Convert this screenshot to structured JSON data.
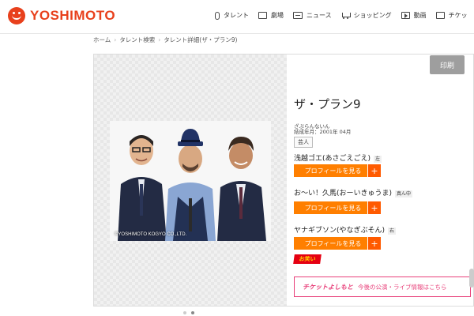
{
  "brand": {
    "name": "YOSHIMOTO",
    "color": "#e8401c"
  },
  "nav": [
    {
      "label": "タレント",
      "icon": "mic-icon"
    },
    {
      "label": "劇場",
      "icon": "theater-icon"
    },
    {
      "label": "ニュース",
      "icon": "news-icon"
    },
    {
      "label": "ショッピング",
      "icon": "cart-icon"
    },
    {
      "label": "動画",
      "icon": "play-icon"
    },
    {
      "label": "チケッ",
      "icon": "ticket-icon"
    }
  ],
  "breadcrumb": [
    "ホーム",
    "タレント検索",
    "タレント詳細(ザ・プラン9)"
  ],
  "print_label": "印刷",
  "talent": {
    "name": "ザ・プラン9",
    "furigana": "ざぷらんないん",
    "formed": "結成年月：2001年 04月",
    "tag": "芸人",
    "copyright": "©YOSHIMOTO KOGYO CO.,LTD."
  },
  "members": [
    {
      "name": "浅越ゴエ(あさごえごえ)",
      "position": "左"
    },
    {
      "name": "お〜い！久馬(おーいきゅうま)",
      "position": "真ん中"
    },
    {
      "name": "ヤナギブソン(やなぎぶそん)",
      "position": "右"
    }
  ],
  "profile_button_label": "プロフィールを見る",
  "plus_symbol": "+",
  "small_logo": "お笑い",
  "ticket": {
    "brand": "チケットよしもと",
    "text": "今後の公演・ライブ情報はこちら"
  },
  "colors": {
    "accent": "#ff7f00",
    "ticket": "#e8407a"
  }
}
